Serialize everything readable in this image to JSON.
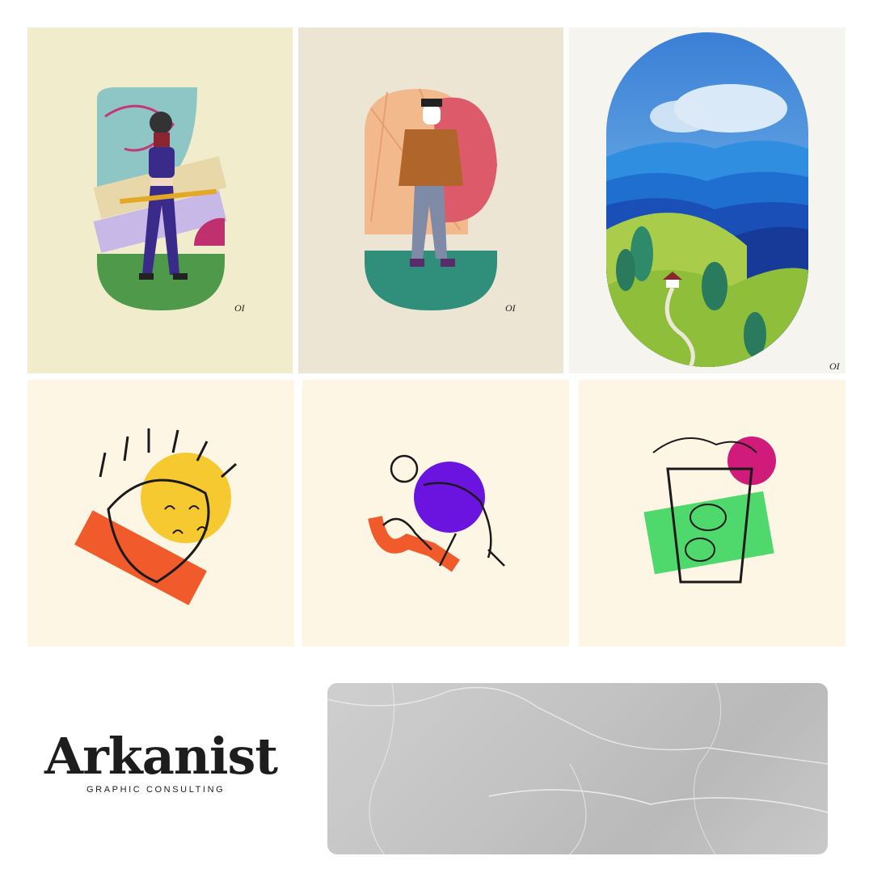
{
  "gallery": {
    "signature": "ΟΙ",
    "tiles": [
      {
        "name": "woman-with-bat-illustration",
        "bg": "#f1eccb"
      },
      {
        "name": "man-in-jacket-illustration",
        "bg": "#ede5d3"
      },
      {
        "name": "mountain-landscape-illustration",
        "bg": "#f6f4ee"
      },
      {
        "name": "taco-sketch",
        "bg": "#fdf6e4"
      },
      {
        "name": "dancing-figures-sketch",
        "bg": "#fdf6e4"
      },
      {
        "name": "mojito-sketch",
        "bg": "#fdf6e4"
      }
    ]
  },
  "brand": {
    "name": "Arkanist",
    "tagline": "GRAPHIC CONSULTING"
  },
  "colors": {
    "accent_orange": "#f15a2b",
    "accent_yellow": "#f5c92f",
    "accent_purple": "#6b14e0",
    "accent_green": "#4fd96d",
    "accent_magenta": "#d01b7a"
  }
}
